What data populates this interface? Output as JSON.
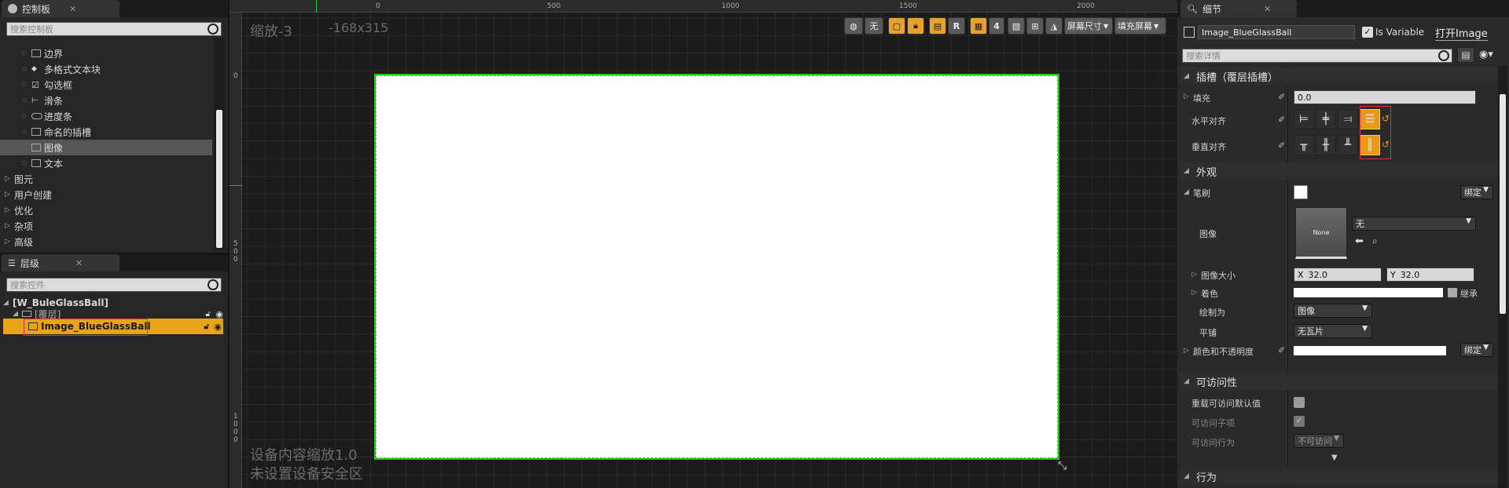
{
  "palette": {
    "title": "控制板",
    "search_placeholder": "搜索控制板",
    "items": [
      {
        "label": "边界",
        "icon": "border-icon"
      },
      {
        "label": "多格式文本块",
        "icon": "richtext-icon"
      },
      {
        "label": "勾选框",
        "icon": "checkbox-icon"
      },
      {
        "label": "滑条",
        "icon": "slider-icon"
      },
      {
        "label": "进度条",
        "icon": "progressbar-icon"
      },
      {
        "label": "命名的插槽",
        "icon": "namedslot-icon"
      },
      {
        "label": "图像",
        "icon": "image-icon"
      },
      {
        "label": "文本",
        "icon": "text-icon"
      }
    ],
    "categories": [
      "图元",
      "用户创建",
      "优化",
      "杂项",
      "高级"
    ]
  },
  "hierarchy": {
    "title": "层级",
    "search_placeholder": "搜索控件",
    "root": "[W_BuleGlassBall]",
    "overlay": "[覆层]",
    "image": "Image_BlueGlassBall"
  },
  "viewport": {
    "zoom_label": "缩放-3",
    "size_label": "-168x315",
    "bottom_line1": "设备内容缩放1.0",
    "bottom_line2": "未设置设备安全区",
    "ruler_top": [
      "0",
      "500",
      "1000",
      "1500",
      "2000"
    ],
    "ruler_left": [
      "0",
      "500",
      "1000"
    ],
    "toolbar": {
      "none": "无",
      "r": "R",
      "grid_num": "4",
      "screen_size": "屏幕尺寸",
      "fill_screen": "填充屏幕"
    }
  },
  "details": {
    "title": "细节",
    "widget_name": "Image_BlueGlassBall",
    "is_variable": "Is Variable",
    "open_image": "打开Image",
    "search_placeholder": "搜索详情",
    "slot_section": "插槽（覆层插槽）",
    "padding_label": "填充",
    "padding_value": "0.0",
    "h_align": "水平对齐",
    "v_align": "垂直对齐",
    "appearance": "外观",
    "brush": "笔刷",
    "bind": "绑定",
    "image_label": "图像",
    "image_none": "None",
    "image_dropdown": "无",
    "image_size": "图像大小",
    "size_x": "32.0",
    "size_y": "32.0",
    "tint": "着色",
    "inherit": "继承",
    "draw_as": "绘制为",
    "draw_as_value": "图像",
    "tiling": "平铺",
    "tiling_value": "无瓦片",
    "color_opacity": "颜色和不透明度",
    "accessibility": "可访问性",
    "override_acc": "重载可访问默认值",
    "acc_children": "可访问子项",
    "acc_behavior": "可访问行为",
    "acc_behavior_value": "不可访问",
    "behavior": "行为"
  },
  "colors": {
    "accent": "#e89a17",
    "selection_outline": "#14c814",
    "highlight": "#e03030"
  }
}
